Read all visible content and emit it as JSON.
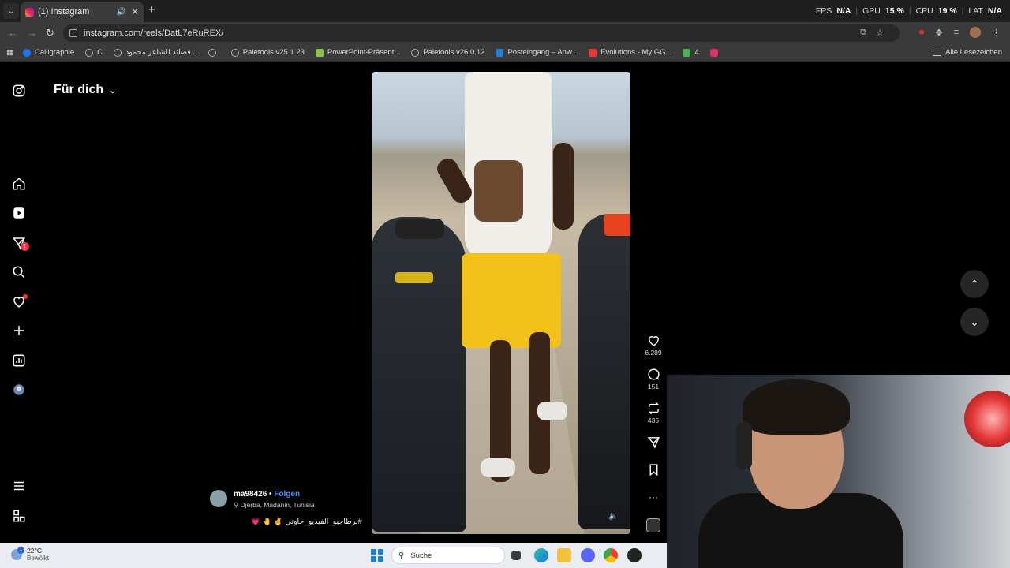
{
  "browser": {
    "tab_menu": "⌄",
    "tab_title": "(1) Instagram",
    "tab_audio": "🔊",
    "tab_close": "✕",
    "new_tab": "+",
    "url": "instagram.com/reels/DatL7eRuREX/",
    "perf": {
      "fps_label": "FPS",
      "fps_value": "N/A",
      "gpu_label": "GPU",
      "gpu_value": "15 %",
      "cpu_label": "CPU",
      "cpu_value": "19 %",
      "lat_label": "LAT",
      "lat_value": "N/A"
    },
    "bookmarks": [
      {
        "label": "Calligraphie",
        "color": "#1877f2"
      },
      {
        "label": "C",
        "color": "#9aa0a6"
      },
      {
        "label": "قصائد للشاعر محمود...",
        "color": "#9aa0a6"
      },
      {
        "label": "",
        "color": "#9aa0a6"
      },
      {
        "label": "Paletools v25.1.23",
        "color": "#9aa0a6"
      },
      {
        "label": "PowerPoint-Präsent...",
        "color": "#8bc34a"
      },
      {
        "label": "Paletools v26.0.12",
        "color": "#9aa0a6"
      },
      {
        "label": "Posteingang – Anw...",
        "color": "#2b7cd3"
      },
      {
        "label": "Evolutions - My GG...",
        "color": "#e53935"
      },
      {
        "label": "4",
        "color": "#4caf50"
      },
      {
        "label": "",
        "color": "#e1306c"
      }
    ],
    "all_bookmarks": "Alle Lesezeichen"
  },
  "instagram": {
    "feed_title": "Für dich",
    "feed_chevron": "⌄",
    "notification_count": "1",
    "reel": {
      "likes": "6.289",
      "comments": "151",
      "reposts": "435",
      "more": "···"
    },
    "author": {
      "username": "ma98426",
      "separator": "•",
      "follow": "Folgen",
      "location": "Djerba, Madanin, Tunisia"
    },
    "caption": "#برطاجيو_الفيديو_حاوتي ✌️ 🤚 💗",
    "nav_up": "⌃",
    "nav_down": "⌄"
  },
  "taskbar": {
    "weather_temp": "22°C",
    "weather_cond": "Bewölkt",
    "weather_badge": "1",
    "search_placeholder": "Suche"
  },
  "colors": {
    "accent_follow": "#4a8df6",
    "notification_red": "#ff3040"
  }
}
